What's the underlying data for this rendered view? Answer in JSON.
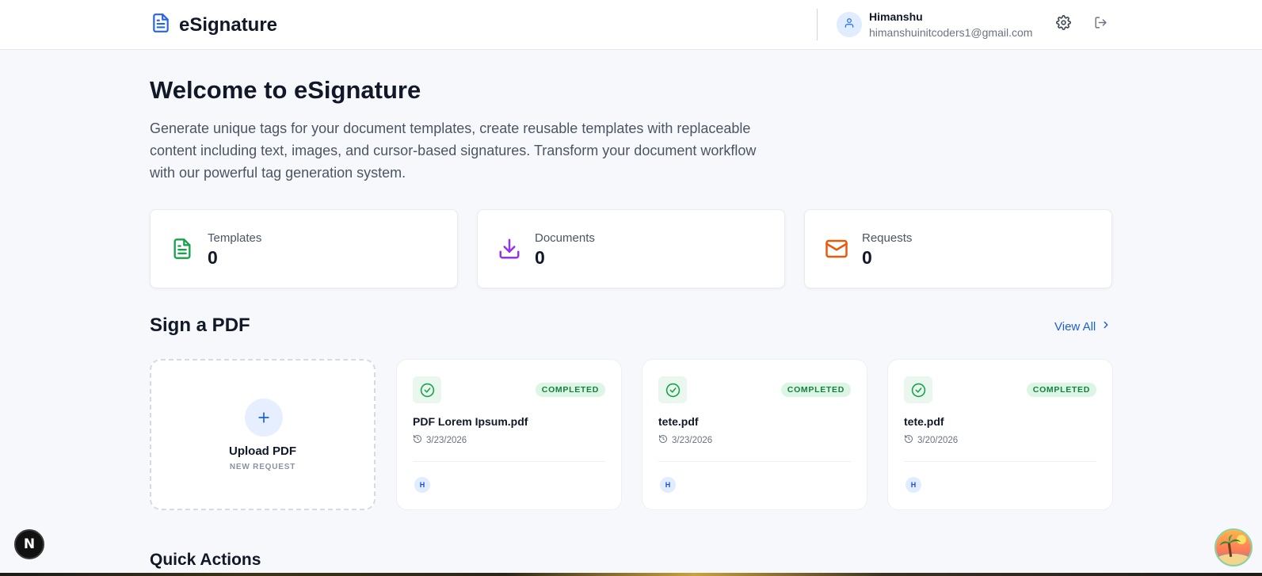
{
  "header": {
    "brand": "eSignature",
    "user": {
      "name": "Himanshu",
      "email": "himanshuinitcoders1@gmail.com"
    }
  },
  "welcome": {
    "title": "Welcome to eSignature",
    "description": "Generate unique tags for your document templates, create reusable templates with replaceable content including text, images, and cursor-based signatures. Transform your document workflow with our powerful tag generation system."
  },
  "stats": [
    {
      "label": "Templates",
      "value": "0",
      "icon": "file-text-icon",
      "color": "#16a34a"
    },
    {
      "label": "Documents",
      "value": "0",
      "icon": "download-icon",
      "color": "#9333ea"
    },
    {
      "label": "Requests",
      "value": "0",
      "icon": "mail-icon",
      "color": "#ea580c"
    }
  ],
  "sign_pdf": {
    "title": "Sign a PDF",
    "view_all": "View All",
    "upload": {
      "title": "Upload PDF",
      "subtitle": "NEW REQUEST"
    },
    "documents": [
      {
        "name": "PDF Lorem Ipsum.pdf",
        "date": "3/23/2026",
        "status": "COMPLETED",
        "avatar": "H"
      },
      {
        "name": "tete.pdf",
        "date": "3/23/2026",
        "status": "COMPLETED",
        "avatar": "H"
      },
      {
        "name": "tete.pdf",
        "date": "3/20/2026",
        "status": "COMPLETED",
        "avatar": "H"
      }
    ]
  },
  "quick_actions": {
    "title": "Quick Actions"
  },
  "dev_badge": {
    "label": "N"
  },
  "colors": {
    "accent": "#1d5fd6",
    "success": "#15803d",
    "background": "#f6f8fb"
  }
}
